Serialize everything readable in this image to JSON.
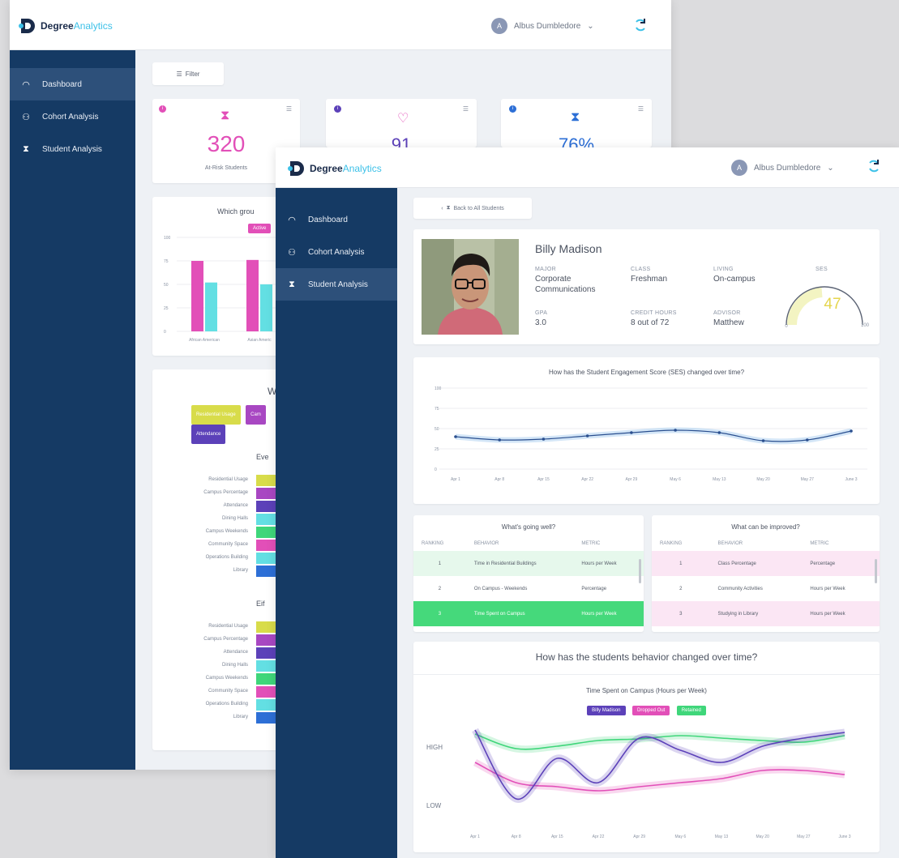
{
  "logo": {
    "brand_a": "Degree",
    "brand_b": "Analytics"
  },
  "user": {
    "initial": "A",
    "name": "Albus Dumbledore"
  },
  "nav": [
    {
      "label": "Dashboard",
      "icon": "dashboard-icon"
    },
    {
      "label": "Cohort Analysis",
      "icon": "people-icon"
    },
    {
      "label": "Student Analysis",
      "icon": "hourglass-icon"
    }
  ],
  "back": {
    "filter_label": "Filter",
    "stats": [
      {
        "value": "320",
        "label": "At-Risk Students",
        "color": "#e24fb8"
      },
      {
        "value": "91",
        "label": "",
        "color": "#5c41b9"
      },
      {
        "value": "76%",
        "label": "",
        "color": "#2d6fd6"
      }
    ],
    "chart1_title": "Which grou",
    "chart1_chip": "Active",
    "chart1_y": [
      "100",
      "75",
      "50",
      "25",
      "0"
    ],
    "chart1_x": [
      "African American",
      "Asian Americ"
    ],
    "chart2_title": "W",
    "chart2_chips": [
      "Residential Usage",
      "Cam",
      "Attendance"
    ],
    "section_a": "Eve",
    "section_b": "Eif",
    "row_labels": [
      "Residential Usage",
      "Campus Percentage",
      "Attendance",
      "Dining Halls",
      "Campus Weekends",
      "Community Space",
      "Operations Building",
      "Library"
    ]
  },
  "front": {
    "back_link": "Back to All Students",
    "student": {
      "name": "Billy Madison",
      "fields": [
        {
          "label": "MAJOR",
          "value": "Corporate Communications"
        },
        {
          "label": "CLASS",
          "value": "Freshman"
        },
        {
          "label": "LIVING",
          "value": "On-campus"
        },
        {
          "label": "GPA",
          "value": "3.0"
        },
        {
          "label": "CREDIT HOURS",
          "value": "8 out of 72"
        },
        {
          "label": "ADVISOR",
          "value": "Matthew"
        }
      ],
      "ses_label": "SES",
      "ses_value": "47",
      "ses_min": "0",
      "ses_max": "100"
    },
    "ses_chart_title": "How has the Student Engagement Score (SES) changed over time?",
    "well": {
      "title": "What's going well?",
      "headers": [
        "RANKING",
        "BEHAVIOR",
        "METRIC"
      ],
      "rows": [
        [
          "1",
          "Time in Residential Buildings",
          "Hours per Week"
        ],
        [
          "2",
          "On Campus - Weekends",
          "Percentage"
        ],
        [
          "3",
          "Time Spent on Campus",
          "Hours per Week"
        ]
      ]
    },
    "improve": {
      "title": "What can be improved?",
      "headers": [
        "RANKING",
        "BEHAVIOR",
        "METRIC"
      ],
      "rows": [
        [
          "1",
          "Class Percentage",
          "Percentage"
        ],
        [
          "2",
          "Community Activities",
          "Hours per Week"
        ],
        [
          "3",
          "Studying in Library",
          "Hours per Week"
        ]
      ]
    },
    "behavior_title": "How has the students behavior changed over time?",
    "behavior_chart_title": "Time Spent on Campus (Hours per Week)",
    "legend": [
      {
        "name": "Billy Madison",
        "color": "#5c41b9"
      },
      {
        "name": "Dropped Out",
        "color": "#e24fb8"
      },
      {
        "name": "Retained",
        "color": "#3fd67a"
      }
    ],
    "high_label": "HIGH",
    "low_label": "LOW"
  },
  "chart_data": [
    {
      "type": "line",
      "title": "How has the Student Engagement Score (SES) changed over time?",
      "x": [
        "Apr 1",
        "Apr 8",
        "Apr 15",
        "Apr 22",
        "Apr 29",
        "May 6",
        "May 13",
        "May 20",
        "May 27",
        "June 3"
      ],
      "y_ticks": [
        "100",
        "75",
        "50",
        "25",
        "0"
      ],
      "ylim": [
        0,
        100
      ],
      "series": [
        {
          "values": [
            40,
            36,
            37,
            41,
            45,
            48,
            45,
            35,
            36,
            47
          ]
        }
      ]
    },
    {
      "type": "line",
      "title": "Time Spent on Campus (Hours per Week)",
      "x": [
        "Apr 1",
        "Apr 8",
        "Apr 15",
        "Apr 22",
        "Apr 29",
        "May 6",
        "May 13",
        "May 20",
        "May 27",
        "June 3"
      ],
      "ylim": [
        "LOW",
        "HIGH"
      ],
      "series": [
        {
          "name": "Billy Madison",
          "values": [
            0.95,
            0.1,
            0.6,
            0.3,
            0.85,
            0.7,
            0.55,
            0.75,
            0.85,
            0.92
          ]
        },
        {
          "name": "Dropped Out",
          "values": [
            0.55,
            0.3,
            0.25,
            0.2,
            0.25,
            0.3,
            0.35,
            0.45,
            0.45,
            0.4
          ]
        },
        {
          "name": "Retained",
          "values": [
            0.9,
            0.72,
            0.75,
            0.82,
            0.84,
            0.88,
            0.85,
            0.82,
            0.8,
            0.88
          ]
        }
      ]
    },
    {
      "type": "bar",
      "title": "Which grou",
      "categories": [
        "African American",
        "Asian Americ"
      ],
      "ylim": [
        0,
        100
      ],
      "series": [
        {
          "values": [
            75,
            76
          ],
          "color": "#e24fb8"
        },
        {
          "values": [
            52,
            50
          ],
          "color": "#63dfe3"
        }
      ]
    }
  ]
}
